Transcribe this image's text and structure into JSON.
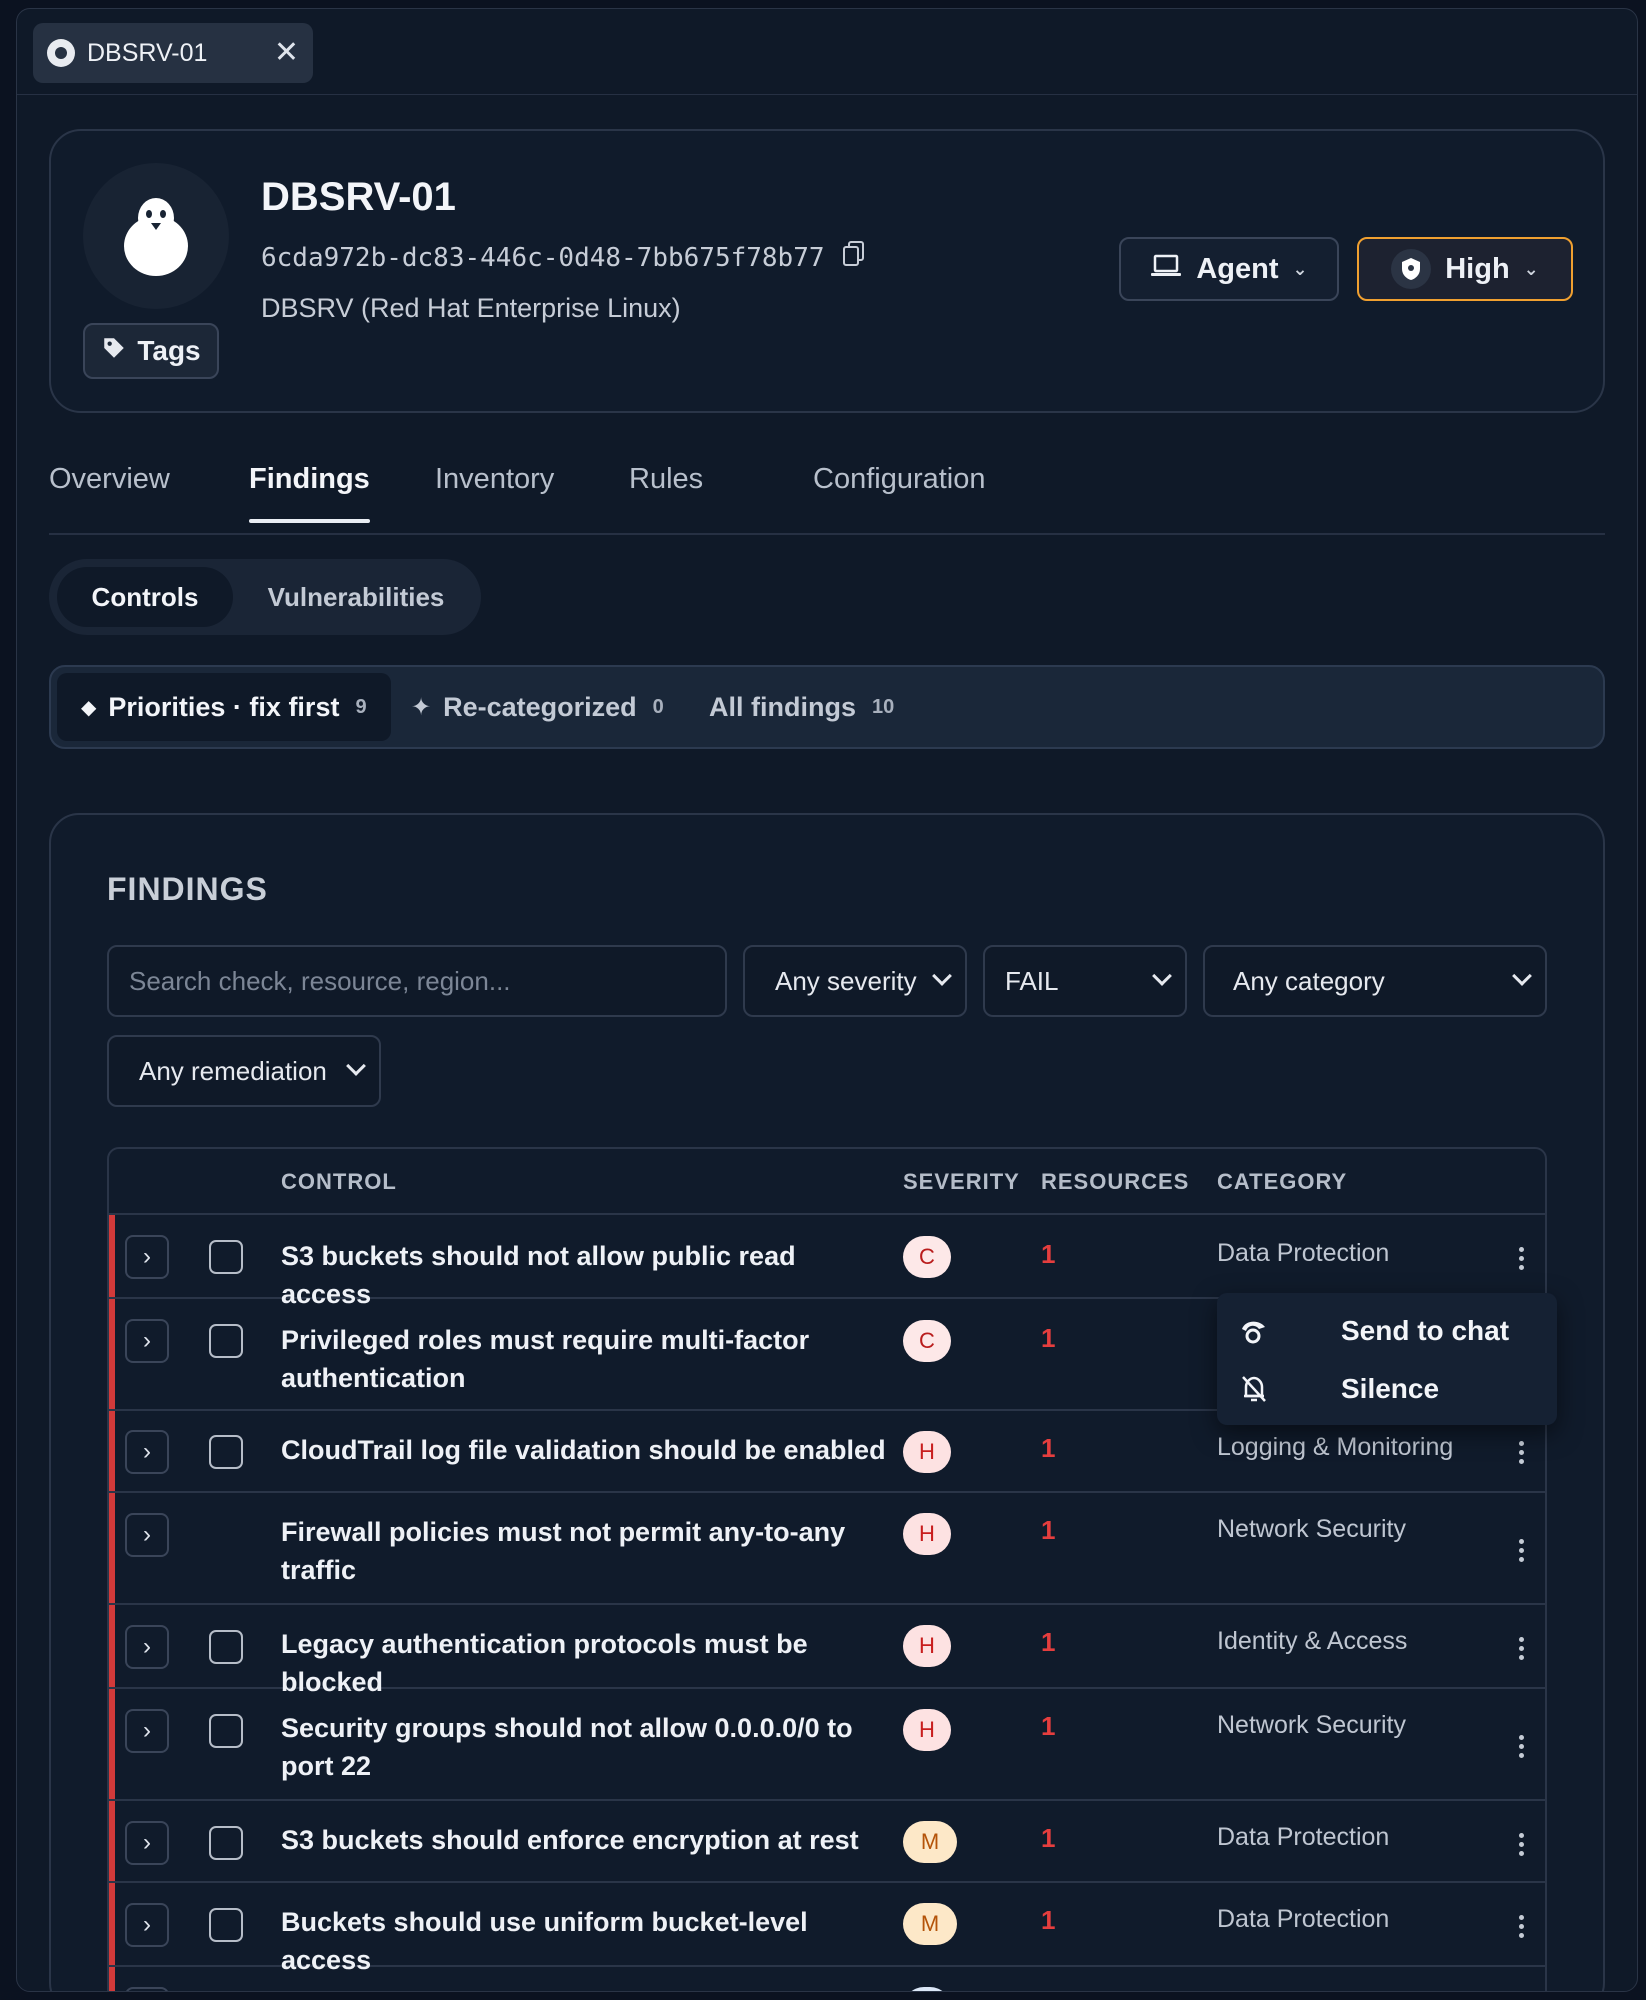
{
  "window_tab": {
    "title": "DBSRV-01",
    "icon": "os-icon",
    "close_icon": "close-icon"
  },
  "host": {
    "name": "DBSRV-01",
    "id": "6cda972b-dc83-446c-0d48-7bb675f78b77",
    "os": "DBSRV (Red Hat Enterprise Linux)",
    "avatar_icon": "linux-penguin-icon",
    "tags_label": "Tags",
    "agent_label": "Agent",
    "risk_label": "High",
    "risk_color": "#f0a030"
  },
  "nav_tabs": [
    "Overview",
    "Findings",
    "Inventory",
    "Rules",
    "Configuration"
  ],
  "active_nav_tab": "Findings",
  "segments": {
    "controls": "Controls",
    "vulnerabilities": "Vulnerabilities",
    "active": "Controls"
  },
  "priority_filters": {
    "priorities": {
      "label": "Priorities · fix first",
      "count": "9"
    },
    "recategorized": {
      "label": "Re-categorized",
      "count": "0"
    },
    "all": {
      "label": "All findings",
      "count": "10"
    }
  },
  "findings": {
    "title": "FINDINGS",
    "search_placeholder": "Search check, resource, region...",
    "severity_filter": "Any severity",
    "status_filter": "FAIL",
    "category_filter": "Any category",
    "remediation_filter": "Any remediation",
    "columns": {
      "control": "CONTROL",
      "severity": "SEVERITY",
      "resources": "RESOURCES",
      "category": "CATEGORY"
    },
    "rows": [
      {
        "control": "S3 buckets should not allow public read access",
        "severity": "C",
        "resources": "1",
        "category": "Data Protection"
      },
      {
        "control": "Privileged roles must require multi-factor authentication",
        "severity": "C",
        "resources": "1",
        "category": ""
      },
      {
        "control": "CloudTrail log file validation should be enabled",
        "severity": "H",
        "resources": "1",
        "category": "Logging & Monitoring"
      },
      {
        "control": "Firewall policies must not permit any-to-any traffic",
        "severity": "H",
        "resources": "1",
        "category": "Network Security"
      },
      {
        "control": "Legacy authentication protocols must be blocked",
        "severity": "H",
        "resources": "1",
        "category": "Identity & Access"
      },
      {
        "control": "Security groups should not allow 0.0.0.0/0 to port 22",
        "severity": "H",
        "resources": "1",
        "category": "Network Security"
      },
      {
        "control": "S3 buckets should enforce encryption at rest",
        "severity": "M",
        "resources": "1",
        "category": "Data Protection"
      },
      {
        "control": "Buckets should use uniform bucket-level access",
        "severity": "M",
        "resources": "1",
        "category": "Data Protection"
      }
    ]
  },
  "context_menu": {
    "send_to_chat": "Send to chat",
    "silence": "Silence"
  },
  "colors": {
    "critical_bar": "#d23a3a",
    "resources_count": "#e53e3e"
  }
}
